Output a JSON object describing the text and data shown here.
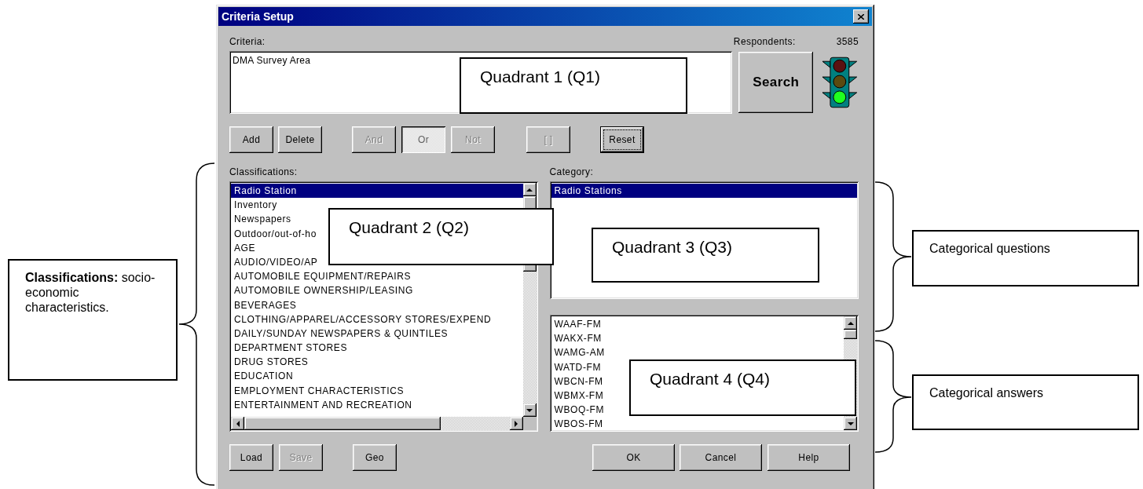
{
  "window": {
    "title": "Criteria Setup"
  },
  "criteria": {
    "label": "Criteria:",
    "value": "DMA Survey Area"
  },
  "respondents": {
    "label": "Respondents:",
    "value": "3585"
  },
  "search_button": {
    "label": "Search"
  },
  "logic_buttons": [
    {
      "label": "Add",
      "disabled": false,
      "pressed": false,
      "focused": false
    },
    {
      "label": "Delete",
      "disabled": false,
      "pressed": false,
      "focused": false
    },
    {
      "label": "And",
      "disabled": true,
      "pressed": false,
      "focused": false
    },
    {
      "label": "Or",
      "disabled": true,
      "pressed": true,
      "focused": false
    },
    {
      "label": "Not",
      "disabled": true,
      "pressed": false,
      "focused": false
    },
    {
      "label": "[ ]",
      "disabled": true,
      "pressed": false,
      "focused": false
    },
    {
      "label": "Reset",
      "disabled": false,
      "pressed": false,
      "focused": true
    }
  ],
  "classifications": {
    "label": "Classifications:",
    "items": [
      {
        "text": "Radio Station",
        "selected": true
      },
      {
        "text": "Inventory",
        "selected": false
      },
      {
        "text": "Newspapers",
        "selected": false
      },
      {
        "text": "Outdoor/out-of-ho",
        "selected": false
      },
      {
        "text": "AGE",
        "selected": false
      },
      {
        "text": "AUDIO/VIDEO/AP",
        "selected": false
      },
      {
        "text": "AUTOMOBILE EQUIPMENT/REPAIRS",
        "selected": false
      },
      {
        "text": "AUTOMOBILE OWNERSHIP/LEASING",
        "selected": false
      },
      {
        "text": "BEVERAGES",
        "selected": false
      },
      {
        "text": "CLOTHING/APPAREL/ACCESSORY STORES/EXPEND",
        "selected": false
      },
      {
        "text": "DAILY/SUNDAY NEWSPAPERS & QUINTILES",
        "selected": false
      },
      {
        "text": "DEPARTMENT STORES",
        "selected": false
      },
      {
        "text": "DRUG STORES",
        "selected": false
      },
      {
        "text": "EDUCATION",
        "selected": false
      },
      {
        "text": "EMPLOYMENT CHARACTERISTICS",
        "selected": false
      },
      {
        "text": "ENTERTAINMENT AND RECREATION",
        "selected": false
      }
    ]
  },
  "category": {
    "label": "Category:",
    "items": [
      {
        "text": "Radio Stations",
        "selected": true
      }
    ]
  },
  "answers": {
    "items": [
      {
        "text": "WAAF-FM",
        "selected": false
      },
      {
        "text": "WAKX-FM",
        "selected": false
      },
      {
        "text": "WAMG-AM",
        "selected": false
      },
      {
        "text": "WATD-FM",
        "selected": false
      },
      {
        "text": "WBCN-FM",
        "selected": false
      },
      {
        "text": "WBMX-FM",
        "selected": false
      },
      {
        "text": "WBOQ-FM",
        "selected": false
      },
      {
        "text": "WBOS-FM",
        "selected": false
      }
    ]
  },
  "bottom_buttons": [
    {
      "label": "Load",
      "disabled": false
    },
    {
      "label": "Save",
      "disabled": true
    },
    {
      "label": "Geo",
      "disabled": false
    },
    {
      "label": "OK",
      "disabled": false
    },
    {
      "label": "Cancel",
      "disabled": false
    },
    {
      "label": "Help",
      "disabled": false
    }
  ],
  "callouts": [
    {
      "kind": "quadrant",
      "text": "Quadrant 1 (Q1)"
    },
    {
      "kind": "quadrant",
      "text": "Quadrant 2 (Q2)"
    },
    {
      "kind": "quadrant",
      "text": "Quadrant 3 (Q3)"
    },
    {
      "kind": "quadrant",
      "text": "Quadrant 4 (Q4)"
    },
    {
      "kind": "note",
      "text": "**Classifications:** socio-economic characteristics."
    },
    {
      "kind": "note",
      "text": "Categorical questions"
    },
    {
      "kind": "note",
      "text": "Categorical answers"
    }
  ]
}
